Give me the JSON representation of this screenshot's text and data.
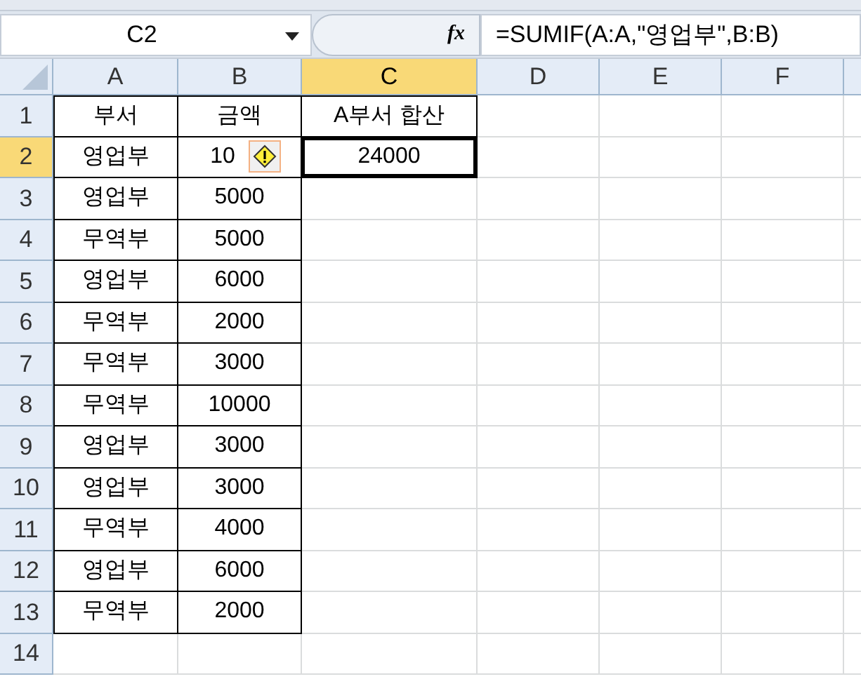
{
  "name_box": {
    "value": "C2"
  },
  "formula_bar": {
    "function_icon": "fx",
    "formula": "=SUMIF(A:A,\"영업부\",B:B)"
  },
  "columns": [
    {
      "label": "A",
      "selected": false
    },
    {
      "label": "B",
      "selected": false
    },
    {
      "label": "C",
      "selected": true
    },
    {
      "label": "D",
      "selected": false
    },
    {
      "label": "E",
      "selected": false
    },
    {
      "label": "F",
      "selected": false
    }
  ],
  "rows": [
    {
      "label": "1",
      "selected": false,
      "cells": [
        {
          "text": "부서",
          "bordered": true
        },
        {
          "text": "금액",
          "bordered": true
        },
        {
          "text": "A부서 합산",
          "bordered": true
        }
      ]
    },
    {
      "label": "2",
      "selected": true,
      "cells": [
        {
          "text": "영업부",
          "bordered": true
        },
        {
          "text": "10",
          "bordered": true,
          "error_flag": true
        },
        {
          "text": "24000",
          "bordered": true,
          "selected": true
        }
      ]
    },
    {
      "label": "3",
      "selected": false,
      "cells": [
        {
          "text": "영업부",
          "bordered": true
        },
        {
          "text": "5000",
          "bordered": true
        }
      ]
    },
    {
      "label": "4",
      "selected": false,
      "cells": [
        {
          "text": "무역부",
          "bordered": true
        },
        {
          "text": "5000",
          "bordered": true
        }
      ]
    },
    {
      "label": "5",
      "selected": false,
      "cells": [
        {
          "text": "영업부",
          "bordered": true
        },
        {
          "text": "6000",
          "bordered": true
        }
      ]
    },
    {
      "label": "6",
      "selected": false,
      "cells": [
        {
          "text": "무역부",
          "bordered": true
        },
        {
          "text": "2000",
          "bordered": true
        }
      ]
    },
    {
      "label": "7",
      "selected": false,
      "cells": [
        {
          "text": "무역부",
          "bordered": true
        },
        {
          "text": "3000",
          "bordered": true
        }
      ]
    },
    {
      "label": "8",
      "selected": false,
      "cells": [
        {
          "text": "무역부",
          "bordered": true
        },
        {
          "text": "10000",
          "bordered": true
        }
      ]
    },
    {
      "label": "9",
      "selected": false,
      "cells": [
        {
          "text": "영업부",
          "bordered": true
        },
        {
          "text": "3000",
          "bordered": true
        }
      ]
    },
    {
      "label": "10",
      "selected": false,
      "cells": [
        {
          "text": "영업부",
          "bordered": true
        },
        {
          "text": "3000",
          "bordered": true
        }
      ]
    },
    {
      "label": "11",
      "selected": false,
      "cells": [
        {
          "text": "무역부",
          "bordered": true
        },
        {
          "text": "4000",
          "bordered": true
        }
      ]
    },
    {
      "label": "12",
      "selected": false,
      "cells": [
        {
          "text": "영업부",
          "bordered": true
        },
        {
          "text": "6000",
          "bordered": true
        }
      ]
    },
    {
      "label": "13",
      "selected": false,
      "cells": [
        {
          "text": "무역부",
          "bordered": true
        },
        {
          "text": "2000",
          "bordered": true
        }
      ]
    },
    {
      "label": "14",
      "selected": false,
      "cells": []
    }
  ]
}
